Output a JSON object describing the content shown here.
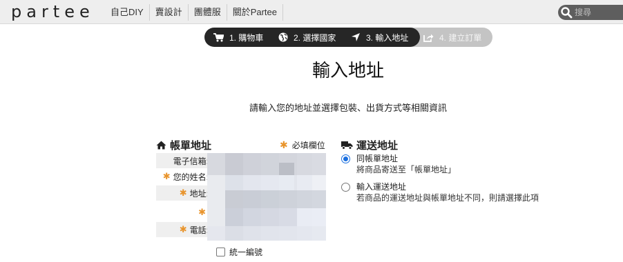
{
  "brand": {
    "logo": "partee"
  },
  "nav": [
    {
      "label": "自己DIY"
    },
    {
      "label": "賣設計"
    },
    {
      "label": "團體服"
    },
    {
      "label": "關於Partee"
    }
  ],
  "search": {
    "placeholder": "搜尋"
  },
  "steps": [
    {
      "label": "1. 購物車",
      "icon": "cart-icon",
      "state": "done"
    },
    {
      "label": "2. 選擇國家",
      "icon": "globe-icon",
      "state": "done"
    },
    {
      "label": "3. 輸入地址",
      "icon": "location-arrow-icon",
      "state": "active"
    },
    {
      "label": "4. 建立訂單",
      "icon": "share-icon",
      "state": "pending"
    }
  ],
  "page": {
    "title": "輸入地址",
    "subtitle": "請輸入您的地址並選擇包裝、出貨方式等相關資訊"
  },
  "billing": {
    "heading": "帳單地址",
    "required_note": "必填欄位",
    "required_mark": "✱",
    "fields": [
      {
        "label": "電子信箱:",
        "required": false
      },
      {
        "label": "您的姓名:",
        "required": true
      },
      {
        "label": "地址:",
        "required": true
      },
      {
        "label": "",
        "required": true
      },
      {
        "label": "電話:",
        "required": true
      }
    ],
    "tax_id_label": "統一編號"
  },
  "shipping": {
    "heading": "運送地址",
    "options": [
      {
        "title": "同帳單地址",
        "desc": "將商品寄送至「帳單地址」",
        "checked": true
      },
      {
        "title": "輸入運送地址",
        "desc": "若商品的運送地址與帳單地址不同，則請選擇此項",
        "checked": false
      }
    ]
  },
  "colors": {
    "accent_star": "#e8942c",
    "step_dark": "#262626",
    "step_pending": "#c4c4c4",
    "radio_blue": "#1a6fe0"
  }
}
